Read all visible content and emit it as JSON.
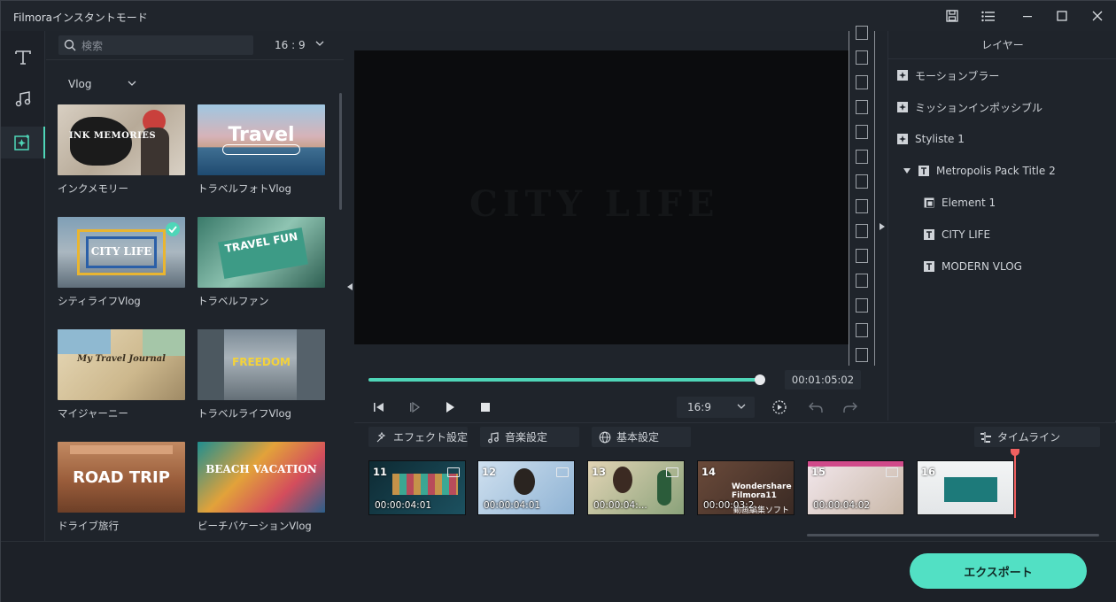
{
  "window": {
    "title": "Filmoraインスタントモード"
  },
  "toolbar": {
    "icons": [
      "save-icon",
      "list-icon",
      "minimize-icon",
      "maximize-icon",
      "close-icon"
    ]
  },
  "rail": {
    "items": [
      {
        "name": "text-icon",
        "active": false
      },
      {
        "name": "music-icon",
        "active": false
      },
      {
        "name": "templates-icon",
        "active": true
      }
    ]
  },
  "templates": {
    "search_placeholder": "検索",
    "ratio": "16 : 9",
    "category": "Vlog",
    "items": [
      {
        "label": "インクメモリー",
        "overlay": "INK MEMORIES",
        "selected": false
      },
      {
        "label": "トラベルフォトVlog",
        "overlay": "Travel",
        "selected": false
      },
      {
        "label": "シティライフVlog",
        "overlay": "CITY LIFE",
        "selected": true
      },
      {
        "label": "トラベルファン",
        "overlay": "TRAVEL FUN",
        "selected": false
      },
      {
        "label": "マイジャーニー",
        "overlay": "My Travel Journal",
        "selected": false
      },
      {
        "label": "トラベルライフVlog",
        "overlay": "FREEDOM",
        "selected": false
      },
      {
        "label": "ドライブ旅行",
        "overlay": "ROAD TRIP",
        "selected": false
      },
      {
        "label": "ビーチバケーションVlog",
        "overlay": "BEACH VACATION",
        "selected": false
      }
    ]
  },
  "preview": {
    "ghost_text": "CITY LIFE",
    "progress": 0.995,
    "timecode": "00:01:05:02",
    "aspect": "16:9"
  },
  "layers": {
    "header": "レイヤー",
    "items": [
      {
        "label": "モーションブラー",
        "indent": 0,
        "expand": false
      },
      {
        "label": "ミッションインポッシブル",
        "indent": 0,
        "expand": false
      },
      {
        "label": "Styliste 1",
        "indent": 0,
        "expand": false
      },
      {
        "label": "Metropolis Pack Title 2",
        "indent": 1,
        "expand": true
      },
      {
        "label": "Element 1",
        "indent": 2,
        "expand": false
      },
      {
        "label": "CITY LIFE",
        "indent": 2,
        "expand": false
      },
      {
        "label": "MODERN VLOG",
        "indent": 2,
        "expand": false
      }
    ]
  },
  "tabs": {
    "effect": "エフェクト設定",
    "music": "音楽設定",
    "basic": "基本設定",
    "timeline": "タイムライン"
  },
  "clips": [
    {
      "num": "11",
      "dur": "00:00:04:01"
    },
    {
      "num": "12",
      "dur": "00:00:04:01"
    },
    {
      "num": "13",
      "dur": "00:00:04:..."
    },
    {
      "num": "14",
      "dur": "00:00:03:2..."
    },
    {
      "num": "15",
      "dur": "00:00:04:02"
    },
    {
      "num": "16",
      "dur": ""
    }
  ],
  "clip_texts": {
    "c14_line1": "Wondershare",
    "c14_line2": "Filmora11",
    "c14_sub": "動画編集ソフト"
  },
  "footer": {
    "export_label": "エクスポート"
  }
}
